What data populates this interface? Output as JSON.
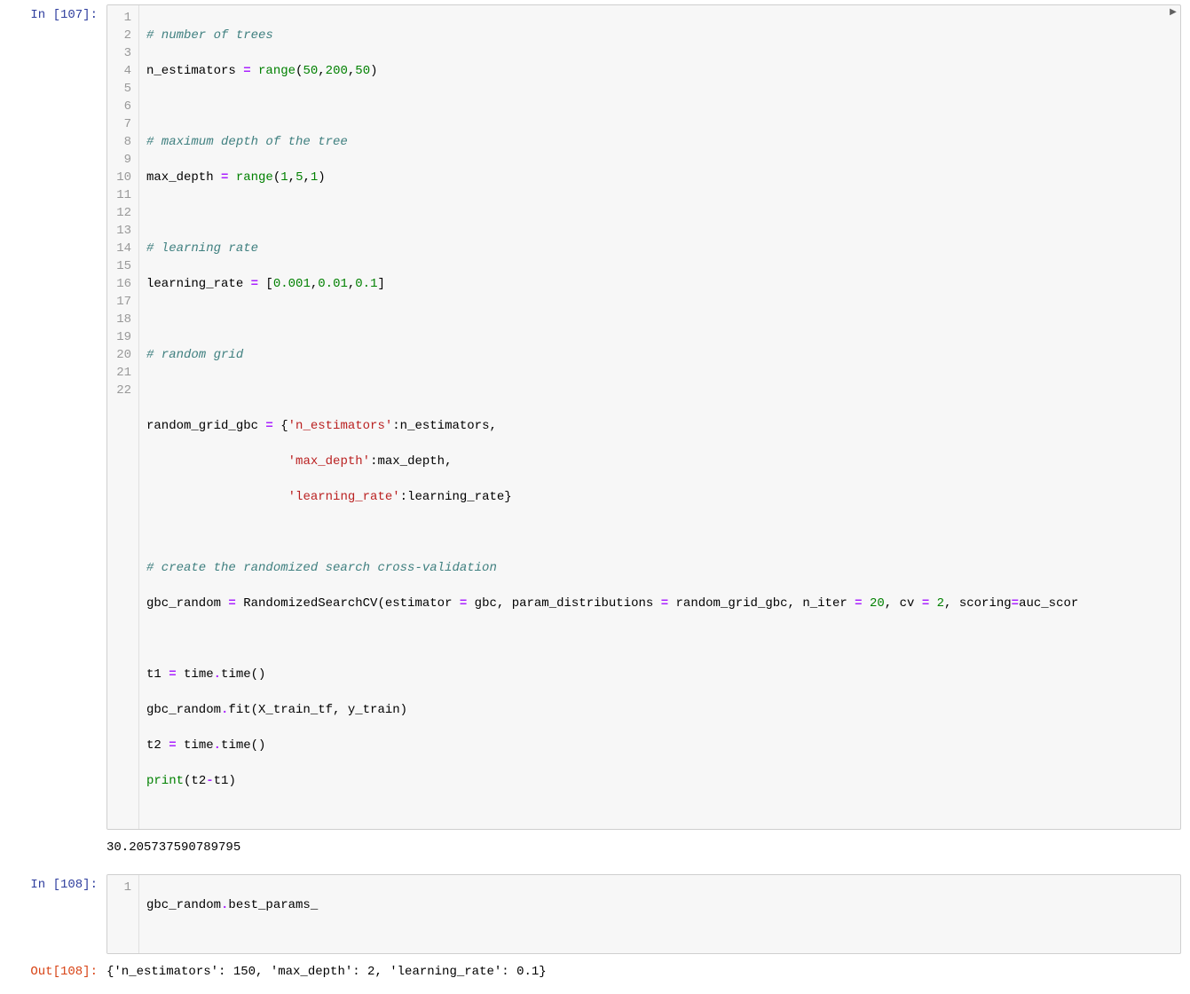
{
  "cells": [
    {
      "prompt_in": "In [107]:",
      "lines": {
        "l1": "# number of trees",
        "l2a": "n_estimators ",
        "l2b": "=",
        "l2c": " ",
        "l2d": "range",
        "l2e": "(",
        "l2f": "50",
        "l2g": ",",
        "l2h": "200",
        "l2i": ",",
        "l2j": "50",
        "l2k": ")",
        "l4": "# maximum depth of the tree",
        "l5a": "max_depth ",
        "l5b": "=",
        "l5c": " ",
        "l5d": "range",
        "l5e": "(",
        "l5f": "1",
        "l5g": ",",
        "l5h": "5",
        "l5i": ",",
        "l5j": "1",
        "l5k": ")",
        "l7": "# learning rate",
        "l8a": "learning_rate ",
        "l8b": "=",
        "l8c": " [",
        "l8d": "0.001",
        "l8e": ",",
        "l8f": "0.01",
        "l8g": ",",
        "l8h": "0.1",
        "l8i": "]",
        "l10": "# random grid",
        "l12a": "random_grid_gbc ",
        "l12b": "=",
        "l12c": " {",
        "l12d": "'n_estimators'",
        "l12e": ":n_estimators,",
        "l13a": "                   ",
        "l13b": "'max_depth'",
        "l13c": ":max_depth,",
        "l14a": "                   ",
        "l14b": "'learning_rate'",
        "l14c": ":learning_rate}",
        "l16": "# create the randomized search cross-validation",
        "l17a": "gbc_random ",
        "l17b": "=",
        "l17c": " RandomizedSearchCV(estimator ",
        "l17d": "=",
        "l17e": " gbc, param_distributions ",
        "l17f": "=",
        "l17g": " random_grid_gbc, n_iter ",
        "l17h": "=",
        "l17i": " ",
        "l17j": "20",
        "l17k": ", cv ",
        "l17l": "=",
        "l17m": " ",
        "l17n": "2",
        "l17o": ", scoring",
        "l17p": "=",
        "l17q": "auc_scor",
        "l19a": "t1 ",
        "l19b": "=",
        "l19c": " time",
        "l19d": ".",
        "l19e": "time()",
        "l20a": "gbc_random",
        "l20b": ".",
        "l20c": "fit(X_train_tf, y_train)",
        "l21a": "t2 ",
        "l21b": "=",
        "l21c": " time",
        "l21d": ".",
        "l21e": "time()",
        "l22a": "print",
        "l22b": "(t2",
        "l22c": "-",
        "l22d": "t1)"
      },
      "gutter": [
        "1",
        "2",
        "3",
        "4",
        "5",
        "6",
        "7",
        "8",
        "9",
        "10",
        "11",
        "12",
        "13",
        "14",
        "15",
        "16",
        "17",
        "18",
        "19",
        "20",
        "21",
        "22"
      ],
      "output": "30.205737590789795"
    },
    {
      "prompt_in": "In [108]:",
      "prompt_out": "Out[108]:",
      "lines": {
        "l1a": "gbc_random",
        "l1b": ".",
        "l1c": "best_params_"
      },
      "gutter": [
        "1"
      ],
      "output": "{'n_estimators': 150, 'max_depth': 2, 'learning_rate': 0.1}"
    }
  ],
  "scrollbar": {
    "thumb_left_pct": 2.5,
    "thumb_width_pct": 70,
    "arrow_left": "◀",
    "arrow_right": "▶"
  }
}
